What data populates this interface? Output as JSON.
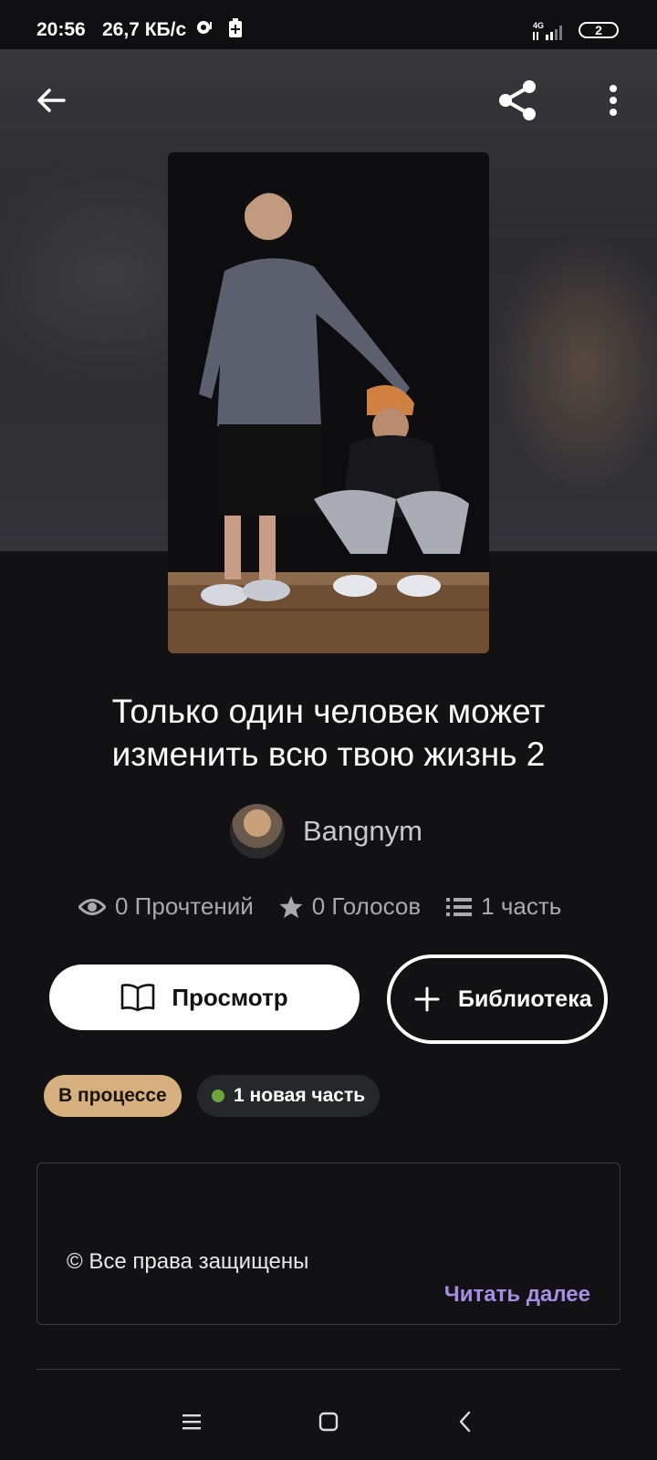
{
  "status_bar": {
    "time": "20:56",
    "speed": "26,7 КБ/с",
    "network": "4G",
    "battery": "2"
  },
  "story": {
    "title": "Только один человек может изменить всю твою жизнь 2",
    "author": "Bangnym",
    "stats": {
      "reads": "0 Прочтений",
      "votes": "0 Голосов",
      "parts": "1 часть"
    }
  },
  "actions": {
    "view_label": "Просмотр",
    "library_label": "Библиотека"
  },
  "tags": {
    "status": "В процессе",
    "new_parts": "1 новая часть"
  },
  "description": {
    "text": "© Все права защищены",
    "read_more": "Читать далее"
  },
  "colors": {
    "background": "#121114",
    "status_tag": "#d6b07e",
    "new_dot": "#6fa63c",
    "link": "#a68ee6"
  },
  "icons": [
    "back-arrow-icon",
    "share-icon",
    "more-vertical-icon",
    "eye-icon",
    "star-icon",
    "list-icon",
    "book-icon",
    "plus-icon",
    "menu-icon",
    "home-icon",
    "back-chevron-icon"
  ]
}
